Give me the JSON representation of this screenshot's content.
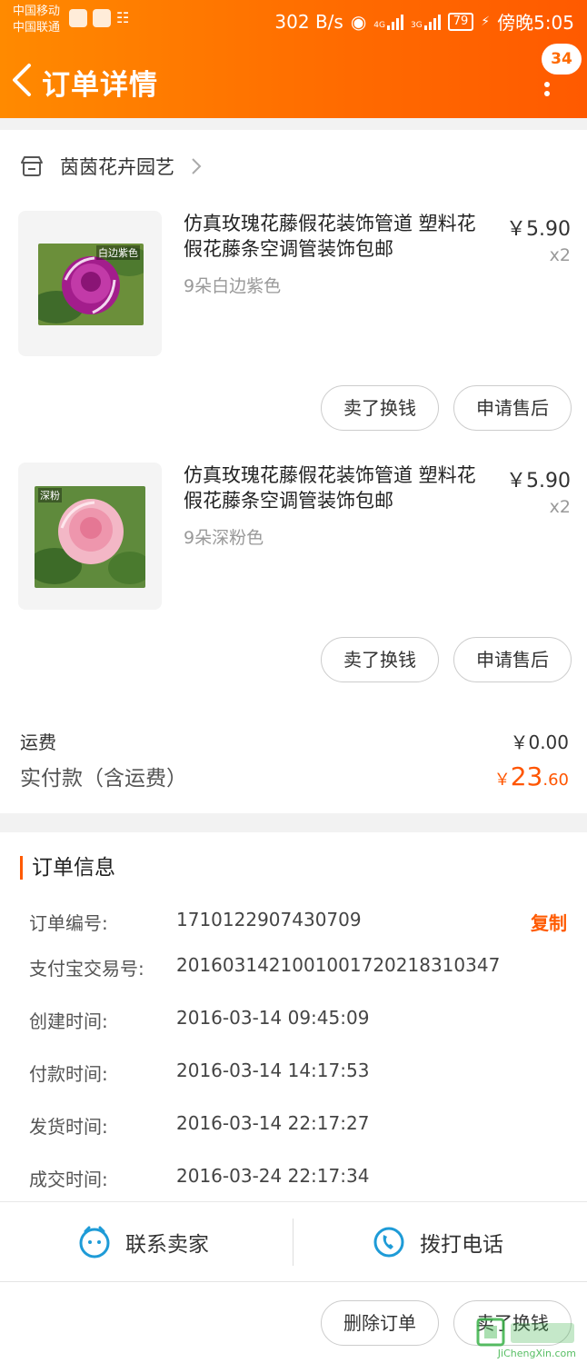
{
  "status_bar": {
    "carrier1": "中国移动",
    "carrier2": "中国联通",
    "speed": "302 B/s",
    "net1": "4G",
    "net2": "3G",
    "battery": "79",
    "time": "傍晚5:05"
  },
  "header": {
    "title": "订单详情",
    "badge": "34",
    "accent": "#ff6a00"
  },
  "shop": {
    "name": "茵茵花卉园艺"
  },
  "items": [
    {
      "title": "仿真玫瑰花藤假花装饰管道 塑料花假花藤条空调管装饰包邮",
      "sku": "9朵白边紫色",
      "price": "￥5.90",
      "qty": "x2",
      "thumb_tag": "白边紫色",
      "btn_sell": "卖了换钱",
      "btn_after": "申请售后"
    },
    {
      "title": "仿真玫瑰花藤假花装饰管道 塑料花假花藤条空调管装饰包邮",
      "sku": "9朵深粉色",
      "price": "￥5.90",
      "qty": "x2",
      "thumb_tag": "深粉",
      "btn_sell": "卖了换钱",
      "btn_after": "申请售后"
    }
  ],
  "fees": {
    "shipping_label": "运费",
    "shipping_value": "￥0.00",
    "paid_label": "实付款（含运费）",
    "paid_currency": "￥",
    "paid_int": "23",
    "paid_dec": ".60"
  },
  "order_info": {
    "title": "订单信息",
    "copy_label": "复制",
    "rows": [
      {
        "label": "订单编号:",
        "value": "1710122907430709"
      },
      {
        "label": "支付宝交易号:",
        "value": "2016031421001001720218310347"
      },
      {
        "label": "创建时间:",
        "value": "2016-03-14 09:45:09"
      },
      {
        "label": "付款时间:",
        "value": "2016-03-14 14:17:53"
      },
      {
        "label": "发货时间:",
        "value": "2016-03-14 22:17:27"
      },
      {
        "label": "成交时间:",
        "value": "2016-03-24 22:17:34"
      }
    ]
  },
  "contact": {
    "seller": "联系卖家",
    "phone": "拨打电话"
  },
  "bottom_bar": {
    "delete": "删除订单",
    "sell": "卖了换钱"
  },
  "watermark": {
    "text": "JiChengXin.com"
  }
}
